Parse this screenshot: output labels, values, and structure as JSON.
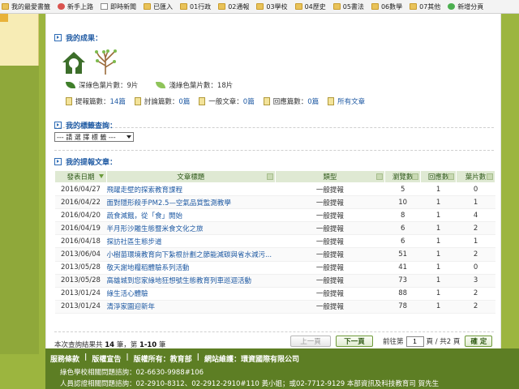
{
  "bookmarks": [
    {
      "label": "我的最愛書籤",
      "icon": "folder"
    },
    {
      "label": "新手上路",
      "icon": "red"
    },
    {
      "label": "即時新聞",
      "icon": "page"
    },
    {
      "label": "已匯入",
      "icon": "folder"
    },
    {
      "label": "01行政",
      "icon": "folder"
    },
    {
      "label": "02通報",
      "icon": "folder"
    },
    {
      "label": "03學校",
      "icon": "folder"
    },
    {
      "label": "04歷史",
      "icon": "folder"
    },
    {
      "label": "05書法",
      "icon": "folder"
    },
    {
      "label": "06數學",
      "icon": "folder"
    },
    {
      "label": "07其他",
      "icon": "folder"
    },
    {
      "label": "新增分頁",
      "icon": "green"
    }
  ],
  "achievements": {
    "heading": "我的成果：",
    "dark_leaf_label": "深綠色葉片數：9片",
    "light_leaf_label": "淺綠色葉片數：18片",
    "stats": [
      {
        "label": "提報篇數：",
        "value": "14篇"
      },
      {
        "label": "討論篇數：",
        "value": "0篇"
      },
      {
        "label": "一般文章：",
        "value": "0篇"
      },
      {
        "label": "回應篇數：",
        "value": "0篇"
      }
    ],
    "all_articles_link": "所有文章"
  },
  "tags": {
    "heading": "我的標籤查詢：",
    "selected": "--- 請 選 擇 標 籤 ---"
  },
  "reports": {
    "heading": "我的提報文章：",
    "columns": [
      "發表日期",
      "文章標題",
      "類型",
      "瀏覽數",
      "回應數",
      "葉片數"
    ],
    "rows": [
      {
        "date": "2016/04/27",
        "title": "飛躍走壁的探索教育課程",
        "type": "一般提報",
        "views": "5",
        "replies": "1",
        "leaves": "0"
      },
      {
        "date": "2016/04/22",
        "title": "面對隱形殺手PM2.5—空氣品質監測教學",
        "type": "一般提報",
        "views": "10",
        "replies": "1",
        "leaves": "1"
      },
      {
        "date": "2016/04/20",
        "title": "蔬食減餓，從「食」開始",
        "type": "一般提報",
        "views": "8",
        "replies": "1",
        "leaves": "4"
      },
      {
        "date": "2016/04/19",
        "title": "半月形沙雕生態暨米食文化之旅",
        "type": "一般提報",
        "views": "6",
        "replies": "1",
        "leaves": "2"
      },
      {
        "date": "2016/04/18",
        "title": "探訪社區生態步道",
        "type": "一般提報",
        "views": "6",
        "replies": "1",
        "leaves": "1"
      },
      {
        "date": "2013/06/04",
        "title": "小樹苗環境教育向下紮根計劃之節能減碳與省水減污...",
        "type": "一般提報",
        "views": "51",
        "replies": "1",
        "leaves": "2"
      },
      {
        "date": "2013/05/28",
        "title": "敬天謝地糧稻體驗系列活動",
        "type": "一般提報",
        "views": "41",
        "replies": "1",
        "leaves": "0"
      },
      {
        "date": "2013/05/28",
        "title": "高雄城到您家綠地狂想號生態教育列車巡迴活動",
        "type": "一般提報",
        "views": "73",
        "replies": "1",
        "leaves": "3"
      },
      {
        "date": "2013/01/24",
        "title": "綠生活心體驗",
        "type": "一般提報",
        "views": "88",
        "replies": "1",
        "leaves": "2"
      },
      {
        "date": "2013/01/24",
        "title": "清淨家園迎新年",
        "type": "一般提報",
        "views": "78",
        "replies": "1",
        "leaves": "2"
      }
    ],
    "result_prefix": "本次查詢結果共 ",
    "result_total": "14",
    "result_mid": " 筆，第 ",
    "result_range": "1-10",
    "result_suffix": " 筆",
    "prev_label": "上一頁",
    "next_label": "下一頁",
    "goto_prefix": "前往第",
    "page_value": "1",
    "goto_suffix": "頁 / 共2 頁",
    "confirm_label": "確 定"
  },
  "footer": {
    "links": [
      "服務條款",
      "|",
      "版權宣告",
      "|",
      "版權所有：教育部",
      "|",
      "網站維護：環資國際有限公司"
    ],
    "line1": "綠色學校相關問題諮詢：02-6630-9988#106",
    "line2": "人員認證相關問題諮詢：02-2910-8312、02-2912-2910#110 黃小姐；或02-7712-9129 本部資訊及科技教育司 賀先生"
  },
  "colors": {
    "accent": "#1f5aa3",
    "bg_green": "#9cb53f",
    "footer_green": "#5d7e24"
  }
}
